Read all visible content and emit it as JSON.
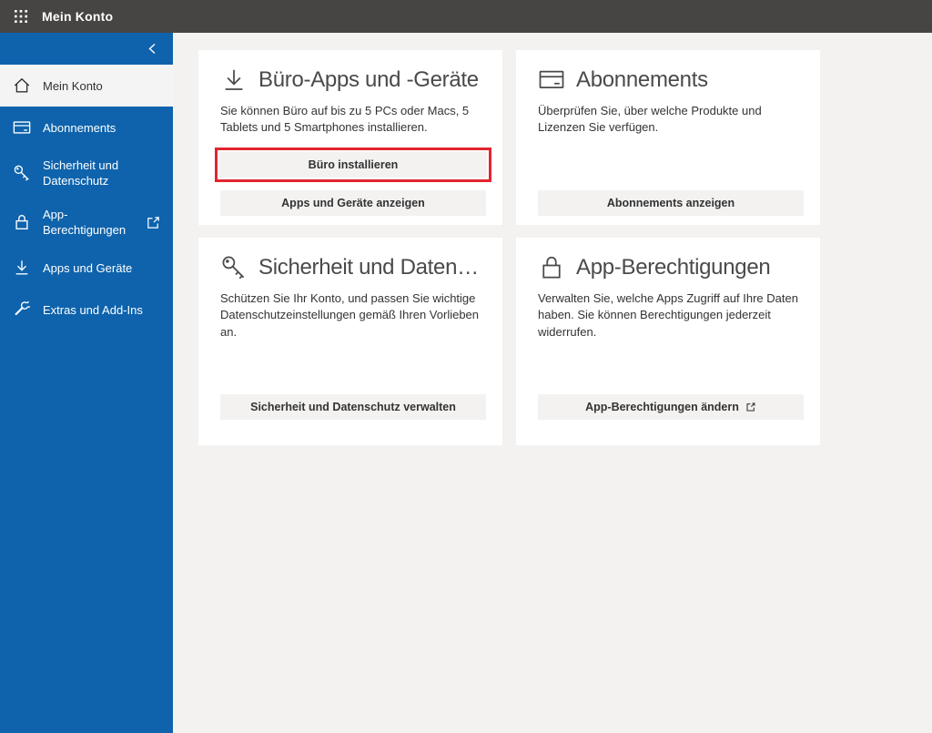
{
  "topbar": {
    "title": "Mein Konto"
  },
  "sidebar": {
    "collapse_icon": "chevron-left-icon",
    "items": [
      {
        "label": "Mein Konto",
        "icon": "home",
        "selected": true
      },
      {
        "label": "Abonnements",
        "icon": "credit-card",
        "selected": false
      },
      {
        "label": "Sicherheit und Datenschutz",
        "icon": "key",
        "selected": false
      },
      {
        "label": "App-Berechtigungen",
        "icon": "lock",
        "selected": false,
        "external": true
      },
      {
        "label": "Apps und Geräte",
        "icon": "download",
        "selected": false
      },
      {
        "label": "Extras und Add-Ins",
        "icon": "wrench",
        "selected": false
      }
    ]
  },
  "cards": [
    {
      "title": "Büro-Apps und -Geräte",
      "icon": "download",
      "description": "Sie können Büro auf bis zu 5 PCs oder Macs, 5 Tablets und 5 Smartphones installieren.",
      "buttons": [
        {
          "label": "Büro installieren",
          "highlighted": true
        },
        {
          "label": "Apps und Geräte anzeigen",
          "highlighted": false
        }
      ]
    },
    {
      "title": "Abonnements",
      "icon": "credit-card",
      "description": "Überprüfen Sie, über welche Produkte und Lizenzen Sie verfügen.",
      "buttons": [
        {
          "label": "Abonnements anzeigen",
          "highlighted": false
        }
      ]
    },
    {
      "title": "Sicherheit und Datensc...",
      "icon": "key",
      "description": "Schützen Sie Ihr Konto, und passen Sie wichtige Datenschutzeinstellungen gemäß Ihren Vorlieben an.",
      "buttons": [
        {
          "label": "Sicherheit und Datenschutz verwalten",
          "highlighted": false
        }
      ]
    },
    {
      "title": "App-Berechtigungen",
      "icon": "lock",
      "description": "Verwalten Sie, welche Apps Zugriff auf Ihre Daten haben. Sie können Berechtigungen jederzeit widerrufen.",
      "buttons": [
        {
          "label": "App-Berechtigungen ändern",
          "highlighted": false,
          "external": true
        }
      ]
    }
  ],
  "colors": {
    "topbar_bg": "#474544",
    "sidebar_bg": "#0E63AC",
    "selected_item_bg": "#F4F4F4",
    "page_bg": "#F3F2F1",
    "card_bg": "#FFFFFF",
    "button_bg": "#F3F2F1",
    "highlight_red": "#E32430",
    "text_dark": "#333333"
  }
}
